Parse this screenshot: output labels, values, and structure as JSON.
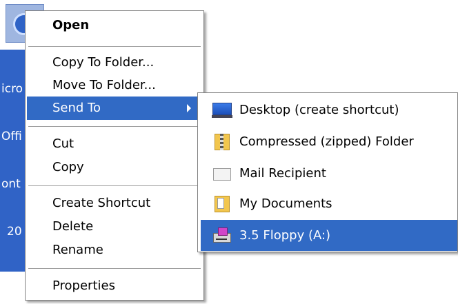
{
  "desktop_icon": {
    "icon": "office-app-icon",
    "label_lines": [
      "icro",
      "Offi",
      "ont",
      "20"
    ]
  },
  "context_menu": {
    "open": "Open",
    "copy_to_folder": "Copy To Folder...",
    "move_to_folder": "Move To Folder...",
    "send_to": "Send To",
    "cut": "Cut",
    "copy": "Copy",
    "create_shortcut": "Create Shortcut",
    "delete": "Delete",
    "rename": "Rename",
    "properties": "Properties"
  },
  "send_to_menu": {
    "items": [
      {
        "label": "Desktop (create shortcut)",
        "icon": "desktop-icon"
      },
      {
        "label": "Compressed (zipped) Folder",
        "icon": "zip-folder-icon"
      },
      {
        "label": "Mail Recipient",
        "icon": "mail-icon"
      },
      {
        "label": "My Documents",
        "icon": "my-documents-icon"
      },
      {
        "label": "3.5 Floppy (A:)",
        "icon": "floppy-drive-icon"
      }
    ],
    "highlighted_index": 4
  },
  "colors": {
    "highlight": "#316ac5",
    "menu_border": "#808080",
    "selected_label": "#3063c6"
  }
}
